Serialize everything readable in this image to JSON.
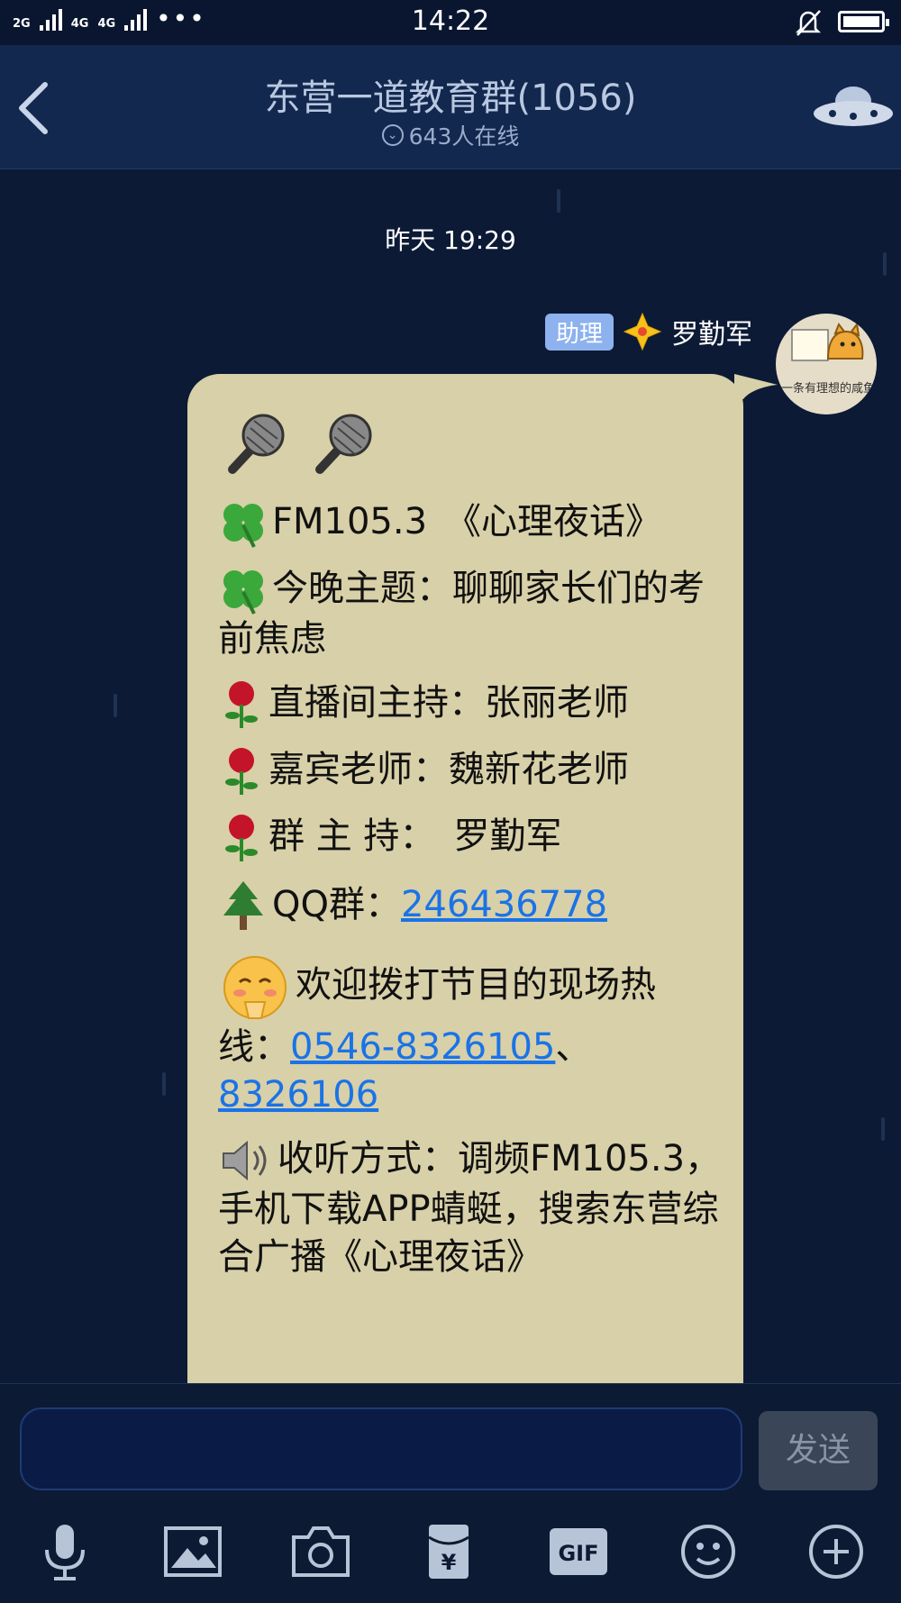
{
  "status_bar": {
    "net1": "2G",
    "net2": "4G",
    "net3": "4G",
    "time": "14:22",
    "more": "•••"
  },
  "header": {
    "title": "东营一道教育群(1056)",
    "subtitle": "643人在线",
    "icons": [
      "back-icon",
      "ufo-icon",
      "chevron-down-icon"
    ]
  },
  "chat": {
    "timestamp": "昨天 19:29",
    "sender": {
      "badge": "助理",
      "name": "罗勤军",
      "avatar_caption": "一条有理想的咸鱼"
    },
    "message": {
      "line_fm": "FM105.3　《心理夜话》",
      "line_topic": "今晚主题：聊聊家长们的考前焦虑",
      "line_host": "直播间主持：张丽老师",
      "line_guest": "嘉宾老师：魏新花老师",
      "line_group_host": "群 主 持：　罗勤军",
      "qq_label": "QQ群：",
      "qq_number": "246436778",
      "hotline_label": "欢迎拨打节目的现场热线：",
      "hotline_1": "0546-8326105",
      "hotline_sep": "、",
      "hotline_2": "8326106",
      "listen": "收听方式：调频FM105.3，手机下载APP蜻蜓，搜索东营综合广播《心理夜话》"
    }
  },
  "input_bar": {
    "placeholder": "",
    "send_label": "发送",
    "tools": [
      "microphone-icon",
      "image-icon",
      "camera-icon",
      "red-packet-icon",
      "gif-icon",
      "emoji-icon",
      "plus-icon"
    ],
    "gif_label": "GIF"
  },
  "colors": {
    "background": "#0c1a35",
    "header": "#13284f",
    "bubble": "#d8d0a8",
    "link": "#1a73e8",
    "badge": "#8db2ee"
  }
}
